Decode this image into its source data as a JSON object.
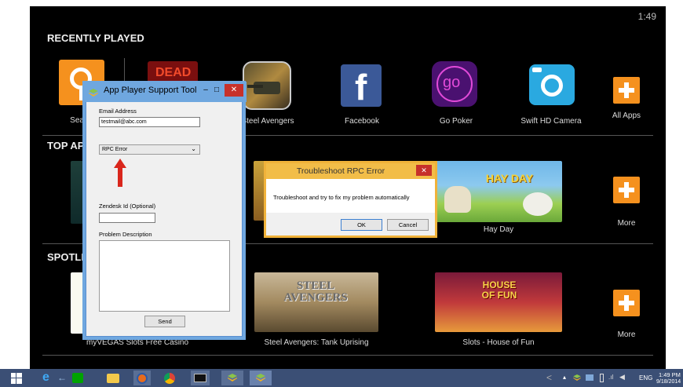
{
  "clock": "1:49",
  "sections": {
    "recently_played": "RECENTLY PLAYED",
    "top_apps": "TOP APPS",
    "spotlight": "SPOTLIGHT"
  },
  "recent_apps": [
    {
      "label": "Search",
      "icon": "search-icon"
    },
    {
      "label": "Steel Avengers",
      "icon": "tank-icon"
    },
    {
      "label": "Facebook",
      "icon": "facebook-icon"
    },
    {
      "label": "Go Poker",
      "icon": "go-poker-icon"
    },
    {
      "label": "Swift HD Camera",
      "icon": "camera-icon"
    },
    {
      "label": "All Apps",
      "icon": "plus-icon"
    }
  ],
  "top_apps": [
    {
      "label": "Hay Day"
    },
    {
      "label": "More"
    }
  ],
  "spotlight": [
    {
      "label": "myVEGAS Slots Free Casino"
    },
    {
      "label": "Steel Avengers: Tank Uprising"
    },
    {
      "label": "Slots - House of Fun"
    },
    {
      "label": "More"
    }
  ],
  "support_window": {
    "title": "App Player Support Tool",
    "email_label": "Email Address",
    "email_value": "testmail@abc.com",
    "issue_selected": "RPC Error",
    "zendesk_label": "Zendesk Id (Optional)",
    "zendesk_value": "",
    "problem_label": "Problem Description",
    "send_label": "Send",
    "minimize": "–",
    "maximize": "□",
    "close": "✕"
  },
  "troubleshoot_dialog": {
    "title": "Troubleshoot RPC Error",
    "message": "Troubleshoot and try to fix my problem automatically",
    "ok_label": "OK",
    "cancel_label": "Cancel",
    "close": "✕"
  },
  "taskbar": {
    "time": "1:49 PM",
    "date": "9/18/2014",
    "language": "ENG"
  },
  "colors": {
    "accent_orange": "#f5911e",
    "taskbar": "#3b4f75",
    "dialog_yellow": "#f2bd48",
    "window_blue": "#6fa7df",
    "arrow_red": "#d9261c"
  },
  "banner_texts": {
    "dead_tile": "DEAD",
    "hay_day": "HAY DAY",
    "steel_avengers": "STEEL AVENGERS",
    "house_of_fun": "HOUSE OF FUN"
  }
}
